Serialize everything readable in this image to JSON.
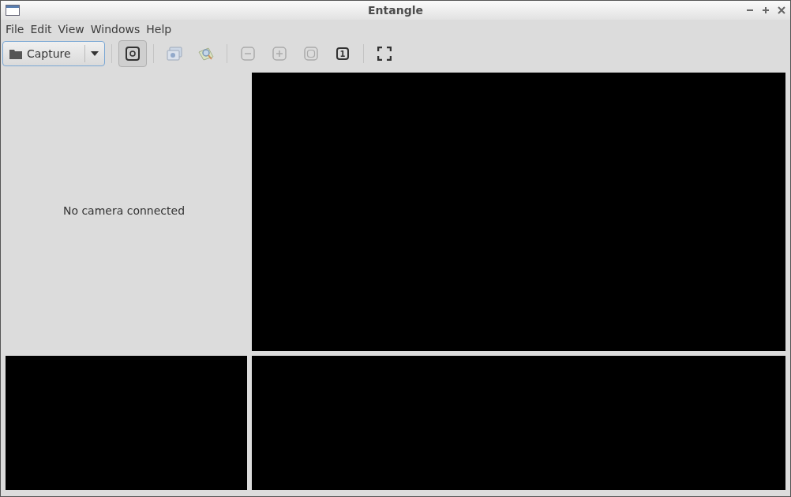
{
  "window": {
    "title": "Entangle"
  },
  "menu": [
    "File",
    "Edit",
    "View",
    "Windows",
    "Help"
  ],
  "toolbar": {
    "mode": {
      "value": "Capture"
    },
    "tools": [
      {
        "kind": "settings",
        "selected": true,
        "disabled": false
      },
      {
        "kind": "sep"
      },
      {
        "kind": "import",
        "disabled": true
      },
      {
        "kind": "preview",
        "disabled": true
      },
      {
        "kind": "sep"
      },
      {
        "kind": "zoom-out",
        "disabled": true
      },
      {
        "kind": "zoom-in",
        "disabled": true
      },
      {
        "kind": "zoom-fit",
        "disabled": true
      },
      {
        "kind": "zoom-normal",
        "label": "1",
        "disabled": false
      },
      {
        "kind": "sep"
      },
      {
        "kind": "fullscreen",
        "disabled": false
      }
    ]
  },
  "camera_panel": {
    "message": "No camera connected"
  }
}
